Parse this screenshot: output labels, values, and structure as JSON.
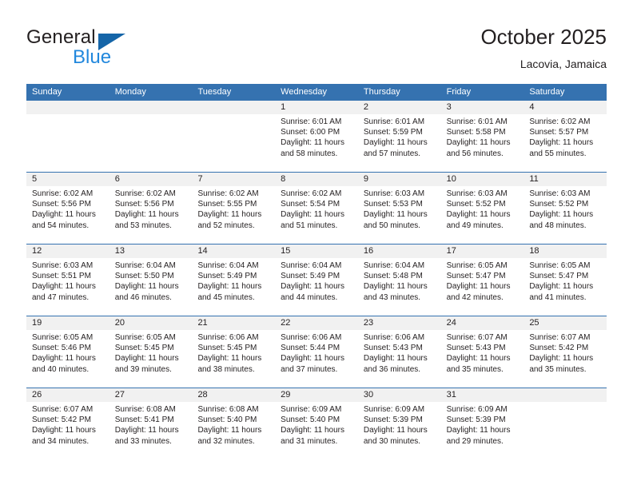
{
  "brand": {
    "name_top": "General",
    "name_bottom": "Blue",
    "triangle_color": "#1565a8",
    "blue_text_color": "#2288dd"
  },
  "header": {
    "title": "October 2025",
    "subtitle": "Lacovia, Jamaica"
  },
  "theme": {
    "header_blue": "#3572b0",
    "daynum_band": "#f1f1f1",
    "text": "#231f20"
  },
  "weekdays": [
    "Sunday",
    "Monday",
    "Tuesday",
    "Wednesday",
    "Thursday",
    "Friday",
    "Saturday"
  ],
  "weeks": [
    [
      {
        "day": "",
        "sunrise": "",
        "sunset": "",
        "daylight1": "",
        "daylight2": ""
      },
      {
        "day": "",
        "sunrise": "",
        "sunset": "",
        "daylight1": "",
        "daylight2": ""
      },
      {
        "day": "",
        "sunrise": "",
        "sunset": "",
        "daylight1": "",
        "daylight2": ""
      },
      {
        "day": "1",
        "sunrise": "Sunrise: 6:01 AM",
        "sunset": "Sunset: 6:00 PM",
        "daylight1": "Daylight: 11 hours",
        "daylight2": "and 58 minutes."
      },
      {
        "day": "2",
        "sunrise": "Sunrise: 6:01 AM",
        "sunset": "Sunset: 5:59 PM",
        "daylight1": "Daylight: 11 hours",
        "daylight2": "and 57 minutes."
      },
      {
        "day": "3",
        "sunrise": "Sunrise: 6:01 AM",
        "sunset": "Sunset: 5:58 PM",
        "daylight1": "Daylight: 11 hours",
        "daylight2": "and 56 minutes."
      },
      {
        "day": "4",
        "sunrise": "Sunrise: 6:02 AM",
        "sunset": "Sunset: 5:57 PM",
        "daylight1": "Daylight: 11 hours",
        "daylight2": "and 55 minutes."
      }
    ],
    [
      {
        "day": "5",
        "sunrise": "Sunrise: 6:02 AM",
        "sunset": "Sunset: 5:56 PM",
        "daylight1": "Daylight: 11 hours",
        "daylight2": "and 54 minutes."
      },
      {
        "day": "6",
        "sunrise": "Sunrise: 6:02 AM",
        "sunset": "Sunset: 5:56 PM",
        "daylight1": "Daylight: 11 hours",
        "daylight2": "and 53 minutes."
      },
      {
        "day": "7",
        "sunrise": "Sunrise: 6:02 AM",
        "sunset": "Sunset: 5:55 PM",
        "daylight1": "Daylight: 11 hours",
        "daylight2": "and 52 minutes."
      },
      {
        "day": "8",
        "sunrise": "Sunrise: 6:02 AM",
        "sunset": "Sunset: 5:54 PM",
        "daylight1": "Daylight: 11 hours",
        "daylight2": "and 51 minutes."
      },
      {
        "day": "9",
        "sunrise": "Sunrise: 6:03 AM",
        "sunset": "Sunset: 5:53 PM",
        "daylight1": "Daylight: 11 hours",
        "daylight2": "and 50 minutes."
      },
      {
        "day": "10",
        "sunrise": "Sunrise: 6:03 AM",
        "sunset": "Sunset: 5:52 PM",
        "daylight1": "Daylight: 11 hours",
        "daylight2": "and 49 minutes."
      },
      {
        "day": "11",
        "sunrise": "Sunrise: 6:03 AM",
        "sunset": "Sunset: 5:52 PM",
        "daylight1": "Daylight: 11 hours",
        "daylight2": "and 48 minutes."
      }
    ],
    [
      {
        "day": "12",
        "sunrise": "Sunrise: 6:03 AM",
        "sunset": "Sunset: 5:51 PM",
        "daylight1": "Daylight: 11 hours",
        "daylight2": "and 47 minutes."
      },
      {
        "day": "13",
        "sunrise": "Sunrise: 6:04 AM",
        "sunset": "Sunset: 5:50 PM",
        "daylight1": "Daylight: 11 hours",
        "daylight2": "and 46 minutes."
      },
      {
        "day": "14",
        "sunrise": "Sunrise: 6:04 AM",
        "sunset": "Sunset: 5:49 PM",
        "daylight1": "Daylight: 11 hours",
        "daylight2": "and 45 minutes."
      },
      {
        "day": "15",
        "sunrise": "Sunrise: 6:04 AM",
        "sunset": "Sunset: 5:49 PM",
        "daylight1": "Daylight: 11 hours",
        "daylight2": "and 44 minutes."
      },
      {
        "day": "16",
        "sunrise": "Sunrise: 6:04 AM",
        "sunset": "Sunset: 5:48 PM",
        "daylight1": "Daylight: 11 hours",
        "daylight2": "and 43 minutes."
      },
      {
        "day": "17",
        "sunrise": "Sunrise: 6:05 AM",
        "sunset": "Sunset: 5:47 PM",
        "daylight1": "Daylight: 11 hours",
        "daylight2": "and 42 minutes."
      },
      {
        "day": "18",
        "sunrise": "Sunrise: 6:05 AM",
        "sunset": "Sunset: 5:47 PM",
        "daylight1": "Daylight: 11 hours",
        "daylight2": "and 41 minutes."
      }
    ],
    [
      {
        "day": "19",
        "sunrise": "Sunrise: 6:05 AM",
        "sunset": "Sunset: 5:46 PM",
        "daylight1": "Daylight: 11 hours",
        "daylight2": "and 40 minutes."
      },
      {
        "day": "20",
        "sunrise": "Sunrise: 6:05 AM",
        "sunset": "Sunset: 5:45 PM",
        "daylight1": "Daylight: 11 hours",
        "daylight2": "and 39 minutes."
      },
      {
        "day": "21",
        "sunrise": "Sunrise: 6:06 AM",
        "sunset": "Sunset: 5:45 PM",
        "daylight1": "Daylight: 11 hours",
        "daylight2": "and 38 minutes."
      },
      {
        "day": "22",
        "sunrise": "Sunrise: 6:06 AM",
        "sunset": "Sunset: 5:44 PM",
        "daylight1": "Daylight: 11 hours",
        "daylight2": "and 37 minutes."
      },
      {
        "day": "23",
        "sunrise": "Sunrise: 6:06 AM",
        "sunset": "Sunset: 5:43 PM",
        "daylight1": "Daylight: 11 hours",
        "daylight2": "and 36 minutes."
      },
      {
        "day": "24",
        "sunrise": "Sunrise: 6:07 AM",
        "sunset": "Sunset: 5:43 PM",
        "daylight1": "Daylight: 11 hours",
        "daylight2": "and 35 minutes."
      },
      {
        "day": "25",
        "sunrise": "Sunrise: 6:07 AM",
        "sunset": "Sunset: 5:42 PM",
        "daylight1": "Daylight: 11 hours",
        "daylight2": "and 35 minutes."
      }
    ],
    [
      {
        "day": "26",
        "sunrise": "Sunrise: 6:07 AM",
        "sunset": "Sunset: 5:42 PM",
        "daylight1": "Daylight: 11 hours",
        "daylight2": "and 34 minutes."
      },
      {
        "day": "27",
        "sunrise": "Sunrise: 6:08 AM",
        "sunset": "Sunset: 5:41 PM",
        "daylight1": "Daylight: 11 hours",
        "daylight2": "and 33 minutes."
      },
      {
        "day": "28",
        "sunrise": "Sunrise: 6:08 AM",
        "sunset": "Sunset: 5:40 PM",
        "daylight1": "Daylight: 11 hours",
        "daylight2": "and 32 minutes."
      },
      {
        "day": "29",
        "sunrise": "Sunrise: 6:09 AM",
        "sunset": "Sunset: 5:40 PM",
        "daylight1": "Daylight: 11 hours",
        "daylight2": "and 31 minutes."
      },
      {
        "day": "30",
        "sunrise": "Sunrise: 6:09 AM",
        "sunset": "Sunset: 5:39 PM",
        "daylight1": "Daylight: 11 hours",
        "daylight2": "and 30 minutes."
      },
      {
        "day": "31",
        "sunrise": "Sunrise: 6:09 AM",
        "sunset": "Sunset: 5:39 PM",
        "daylight1": "Daylight: 11 hours",
        "daylight2": "and 29 minutes."
      },
      {
        "day": "",
        "sunrise": "",
        "sunset": "",
        "daylight1": "",
        "daylight2": ""
      }
    ]
  ]
}
